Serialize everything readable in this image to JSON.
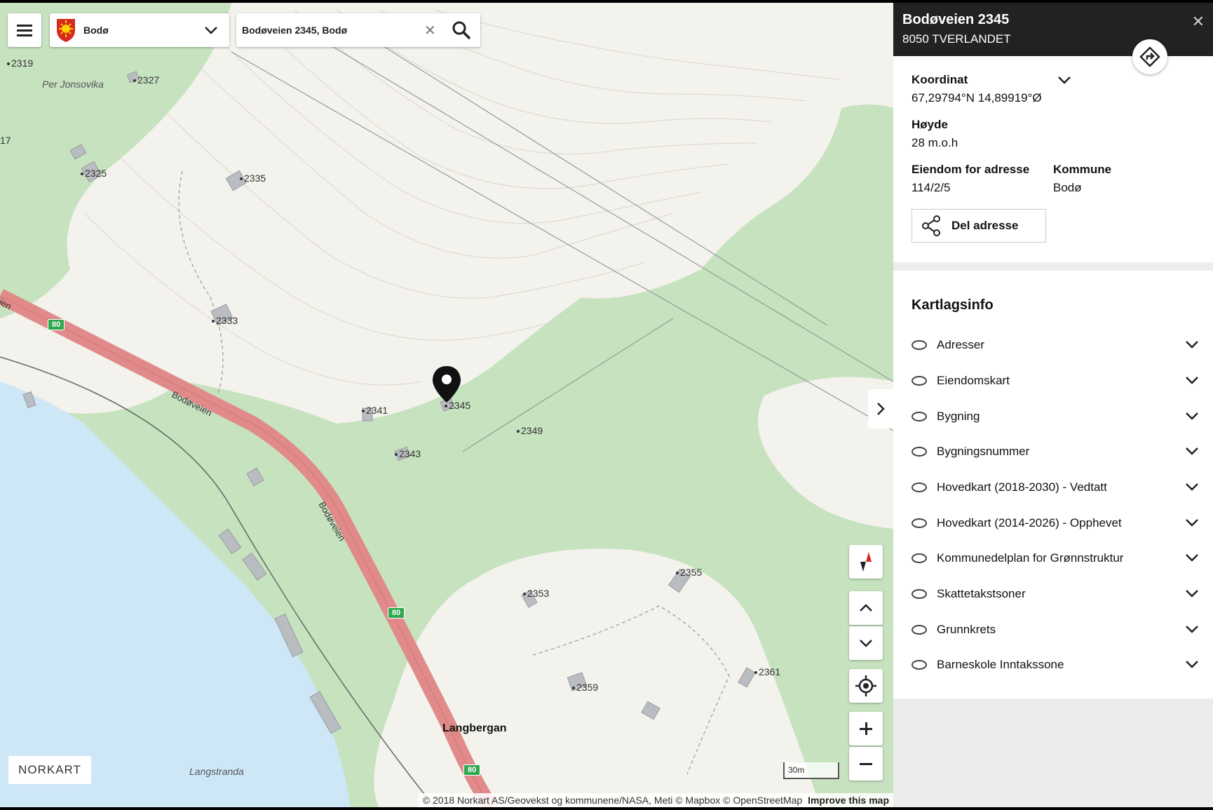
{
  "toolbar": {
    "municipality": "Bodø",
    "search_value": "Bodøveien 2345, Bodø"
  },
  "map": {
    "place_names": [
      "Per Jonsovika",
      "Langstranda"
    ],
    "town": "Langbergan",
    "road_name": "Bodøveien",
    "road_number": "80",
    "address_labels": [
      "2319",
      "2327",
      "2325",
      "2335",
      "2333",
      "2341",
      "2345",
      "2343",
      "2349",
      "2355",
      "2353",
      "2359",
      "2361",
      "17",
      "ien"
    ],
    "scale_label": "30m",
    "brand": "NORKART",
    "attribution": "© 2018 Norkart AS/Geovekst og kommunene/NASA, Meti © Mapbox © OpenStreetMap",
    "attribution_link": "Improve this map",
    "colors": {
      "land": "#f3f2ec",
      "forest": "#c6e2bf",
      "water": "#cde7f7",
      "road": "#e08a8a"
    }
  },
  "panel": {
    "title": "Bodøveien 2345",
    "subtitle": "8050 TVERLANDET",
    "close": "✕",
    "coord_label": "Koordinat",
    "coord_value": "67,29794°N 14,89919°Ø",
    "height_label": "Høyde",
    "height_value": "28 m.o.h",
    "property_label": "Eiendom for adresse",
    "property_value": "114/2/5",
    "kommune_label": "Kommune",
    "kommune_value": "Bodø",
    "share_label": "Del adresse",
    "layers_title": "Kartlagsinfo",
    "layers": [
      "Adresser",
      "Eiendomskart",
      "Bygning",
      "Bygningsnummer",
      "Hovedkart (2018-2030) - Vedtatt",
      "Hovedkart (2014-2026) - Opphevet",
      "Kommunedelplan for Grønnstruktur",
      "Skattetakstsoner",
      "Grunnkrets",
      "Barneskole Inntakssone"
    ]
  }
}
